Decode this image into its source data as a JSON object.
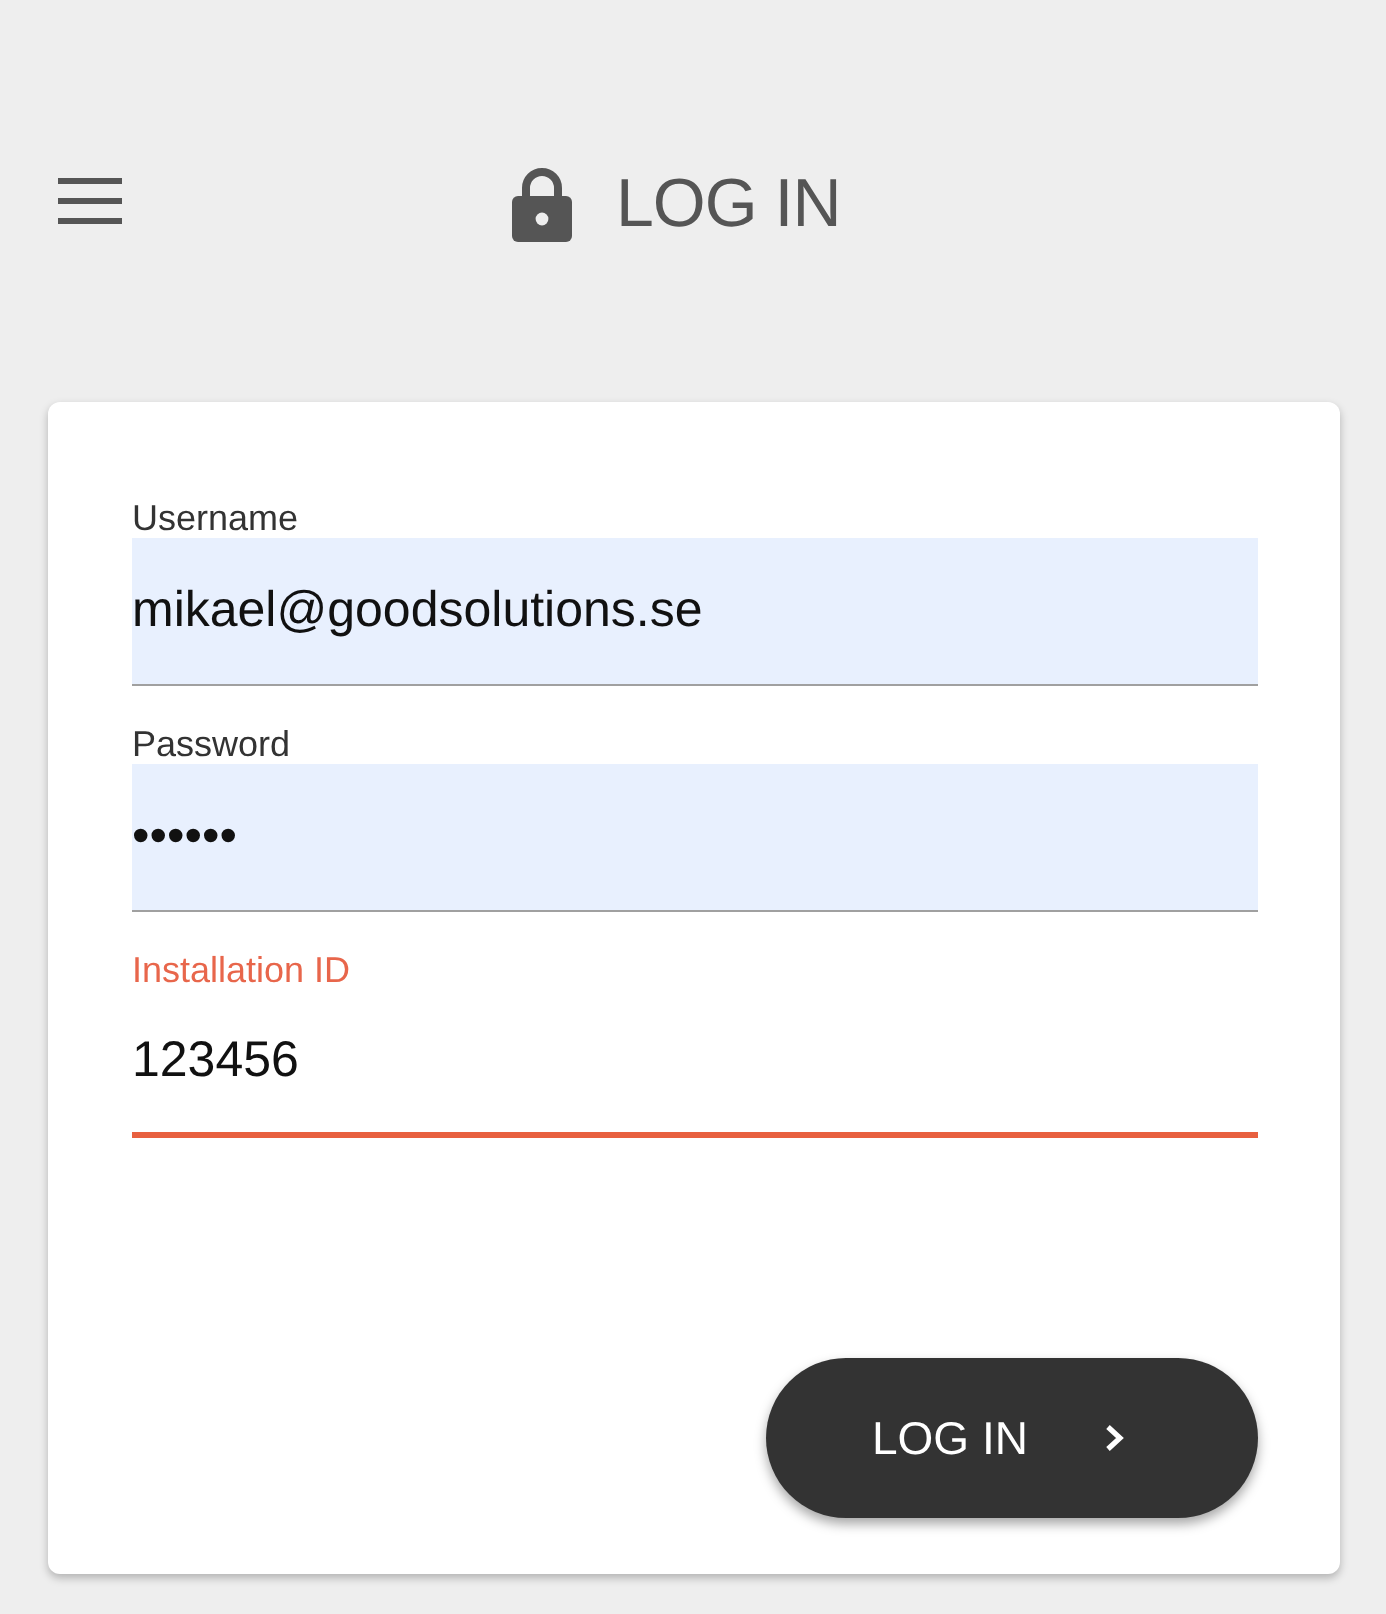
{
  "header": {
    "title": "LOG IN"
  },
  "form": {
    "fields": [
      {
        "label": "Username",
        "value": "mikael@goodsolutions.se",
        "autofilled": true,
        "focused": false
      },
      {
        "label": "Password",
        "value": "••••••",
        "autofilled": true,
        "focused": false
      },
      {
        "label": "Installation ID",
        "value": "123456",
        "autofilled": false,
        "focused": true
      }
    ]
  },
  "submit_button": {
    "label": "LOG IN"
  }
}
